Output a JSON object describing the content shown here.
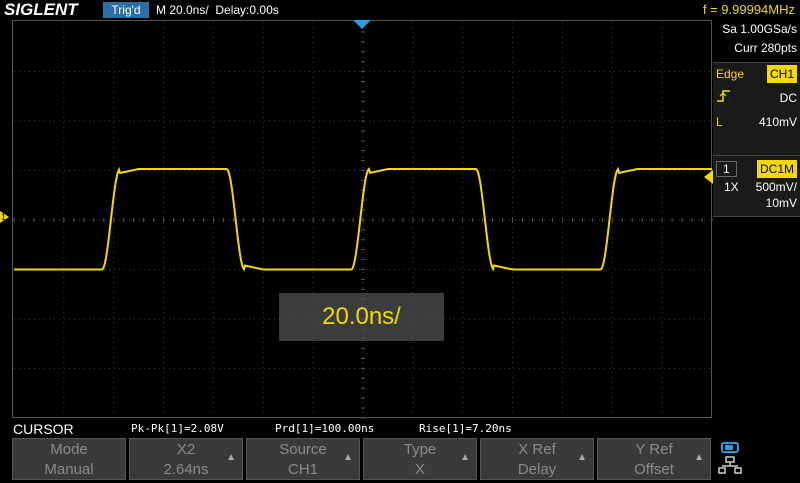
{
  "header": {
    "brand": "SIGLENT",
    "trigger_status": "Trig'd",
    "timebase": "M 20.0ns/",
    "delay": "Delay:0.00s",
    "frequency": "f = 9.99994MHz"
  },
  "acquisition": {
    "sample_rate": "Sa 1.00GSa/s",
    "points": "Curr 280pts"
  },
  "trigger": {
    "type": "Edge",
    "source": "CH1",
    "slope_icon": "rising-edge-icon",
    "coupling": "DC",
    "level_label": "L",
    "level": "410mV"
  },
  "channel": {
    "number": "1",
    "impedance": "DC1M",
    "probe": "1X",
    "scale": "500mV/",
    "offset": "10mV",
    "marker": "1"
  },
  "popup": {
    "text": "20.0ns/"
  },
  "measurements": {
    "menu_title": "CURSOR",
    "pk_pk": "Pk-Pk[1]=2.08V",
    "period": "Prd[1]=100.00ns",
    "rise": "Rise[1]=7.20ns"
  },
  "softkeys": [
    {
      "title": "Mode",
      "value": "Manual",
      "arrow": ""
    },
    {
      "title": "X2",
      "value": "2.64ns",
      "arrow": "▲"
    },
    {
      "title": "Source",
      "value": "CH1",
      "arrow": "▲"
    },
    {
      "title": "Type",
      "value": "X",
      "arrow": "▲"
    },
    {
      "title": "X Ref",
      "value": "Delay",
      "arrow": "▲"
    },
    {
      "title": "Y Ref",
      "value": "Offset",
      "arrow": "▲"
    }
  ],
  "colors": {
    "trace": "#f2d900",
    "trigger_marker": "#2a9be0",
    "trig_badge": "#2b6fa6"
  },
  "waveform": {
    "period_ns": 100,
    "time_per_div_ns": 20,
    "low_level_div": -1,
    "high_level_div": 1.03,
    "rise_time_ns": 7.2
  }
}
